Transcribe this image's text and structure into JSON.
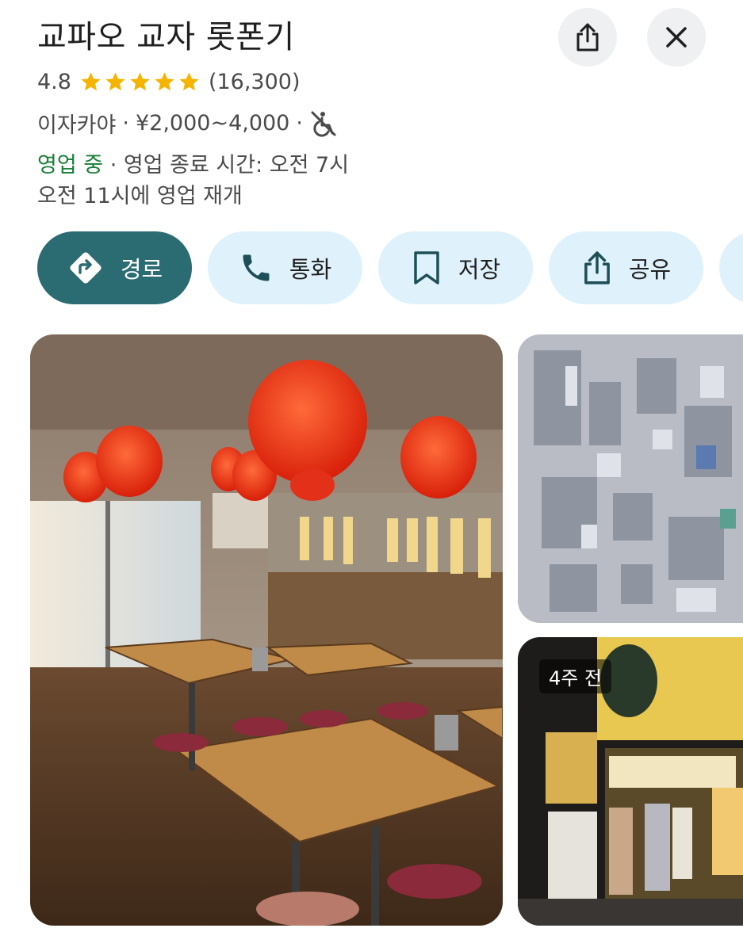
{
  "place": {
    "name": "교파오 교자 롯폰기",
    "rating": "4.8",
    "review_count": "(16,300)",
    "stars_filled": 5,
    "category": "이자카야",
    "price_range": "¥2,000~4,000",
    "separator": "·",
    "wheelchair_icon": "no-wheelchair-access-icon",
    "open_status": "영업 중",
    "closing_text": "영업 종료 시간: 오전 7시",
    "reopen_text": "오전 11시에 영업 재개"
  },
  "header_buttons": {
    "share_icon": "share-icon",
    "close_icon": "close-icon"
  },
  "actions": [
    {
      "label": "경로",
      "icon": "directions-icon"
    },
    {
      "label": "통화",
      "icon": "phone-icon"
    },
    {
      "label": "저장",
      "icon": "bookmark-icon"
    },
    {
      "label": "공유",
      "icon": "share-icon"
    }
  ],
  "photos": {
    "main_alt": "restaurant interior with red lanterns",
    "side_top_alt": "aerial city view",
    "side_bottom_alt": "restaurant storefront at night",
    "age_badge": "4주 전"
  },
  "colors": {
    "primary_action": "#2b6b72",
    "secondary_action": "#dff2fb",
    "star": "#f5b400",
    "open_green": "#188038"
  }
}
